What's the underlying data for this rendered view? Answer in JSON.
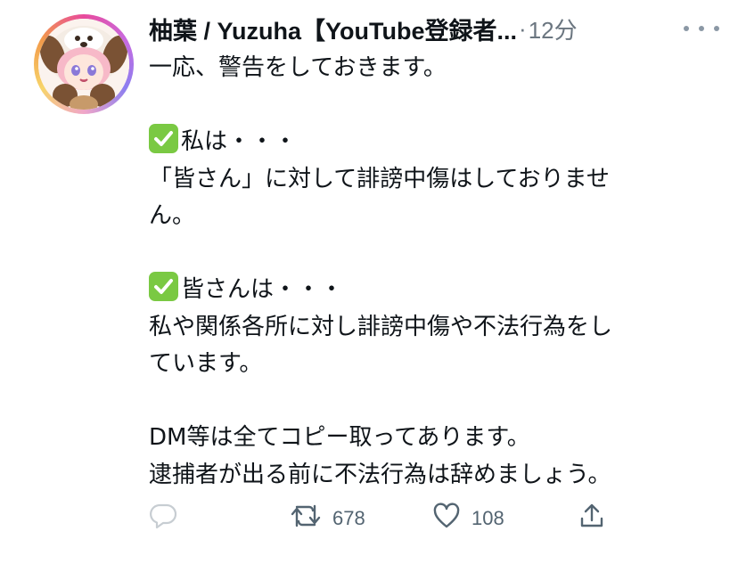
{
  "author": {
    "display_name": "柚葉 / Yuzuha【YouTube登録者...",
    "separator": "·",
    "time": "12分"
  },
  "body": {
    "lines": [
      "一応、警告をしておきます。",
      "",
      "私は・・・",
      "「皆さん」に対して誹謗中傷はしておりませ",
      "ん。",
      "",
      "皆さんは・・・",
      "私や関係各所に対し誹謗中傷や不法行為をし",
      "ています。",
      "",
      "DM等は全てコピー取ってあります。",
      "逮捕者が出る前に不法行為は辞めましょう。"
    ]
  },
  "actions": {
    "reply_count": "",
    "retweet_count": "678",
    "like_count": "108"
  },
  "icons": {
    "avatar": "avatar-icon",
    "more": "more-icon",
    "check": "check-mark-icon",
    "reply": "reply-icon",
    "retweet": "retweet-icon",
    "like": "like-icon",
    "share": "share-icon"
  },
  "colors": {
    "text": "#0f1419",
    "muted": "#6b7680",
    "icon": "#536471",
    "check": "#7ac943"
  }
}
